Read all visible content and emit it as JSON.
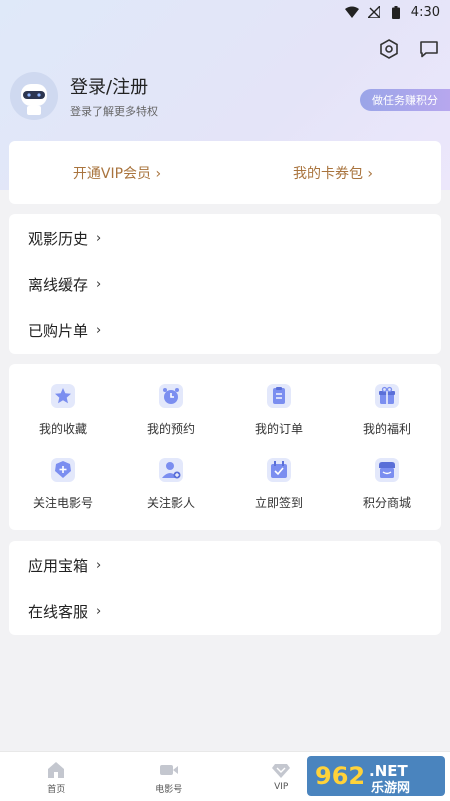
{
  "status_bar": {
    "time": "4:30",
    "icons": [
      "wifi-icon",
      "no-signal-icon",
      "battery-icon"
    ]
  },
  "header": {
    "icons": [
      "settings-icon",
      "message-icon"
    ]
  },
  "profile": {
    "title": "登录/注册",
    "subtitle": "登录了解更多特权",
    "avatar_icon": "robot-avatar-icon"
  },
  "task_badge": "做任务赚积分",
  "vip_card": {
    "vip_label": "开通VIP会员 ›",
    "coupon_label": "我的卡券包 ›"
  },
  "list1": [
    {
      "label": "观影历史"
    },
    {
      "label": "离线缓存"
    },
    {
      "label": "已购片单"
    }
  ],
  "grid": [
    {
      "label": "我的收藏",
      "icon": "star-icon"
    },
    {
      "label": "我的预约",
      "icon": "clock-icon"
    },
    {
      "label": "我的订单",
      "icon": "clipboard-icon"
    },
    {
      "label": "我的福利",
      "icon": "gift-icon"
    },
    {
      "label": "关注电影号",
      "icon": "add-badge-icon"
    },
    {
      "label": "关注影人",
      "icon": "add-person-icon"
    },
    {
      "label": "立即签到",
      "icon": "calendar-check-icon"
    },
    {
      "label": "积分商城",
      "icon": "store-icon"
    }
  ],
  "list2": [
    {
      "label": "应用宝箱"
    },
    {
      "label": "在线客服"
    }
  ],
  "chevron": "›",
  "bottom_nav": [
    {
      "label": "首页",
      "icon": "home-icon"
    },
    {
      "label": "电影号",
      "icon": "video-icon"
    },
    {
      "label": "VIP",
      "icon": "diamond-icon"
    },
    {
      "label": "",
      "icon": ""
    }
  ],
  "watermark": {
    "text_number": "962",
    "text_net": ".NET",
    "text_cn": "乐游网"
  },
  "colors": {
    "accent_gold": "#a9743e",
    "icon_blue": "#7b8ef0",
    "badge": "#a7a6ec"
  }
}
